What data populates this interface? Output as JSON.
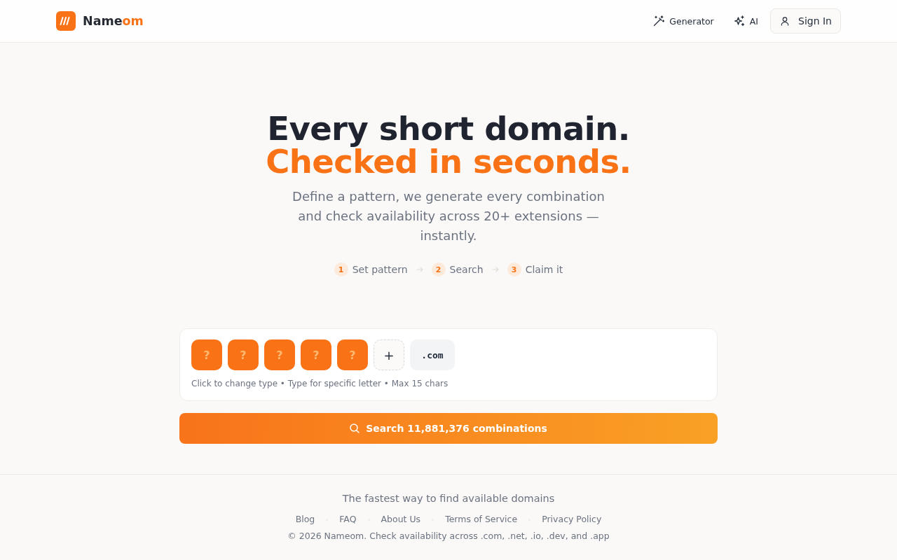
{
  "header": {
    "brand": {
      "name_start": "Name",
      "name_accent": "om"
    },
    "nav_links": [
      {
        "label": "Generator"
      },
      {
        "label": "AI"
      }
    ],
    "sign_in_button": {
      "label": "Sign In"
    }
  },
  "hero": {
    "title_line_1": "Every short domain.",
    "title_line_2": "Checked in seconds.",
    "subtitle": "Define a pattern, we generate every combination and check availability across 20+ extensions — instantly.",
    "steps": [
      {
        "number": "1",
        "label": "Set pattern"
      },
      {
        "number": "2",
        "label": "Search"
      },
      {
        "number": "3",
        "label": "Claim it"
      }
    ]
  },
  "pattern_builder": {
    "slots": [
      {
        "kind": "wildcard",
        "label": "?"
      },
      {
        "kind": "wildcard",
        "label": "?"
      },
      {
        "kind": "wildcard",
        "label": "?"
      },
      {
        "kind": "wildcard",
        "label": "?"
      },
      {
        "kind": "wildcard",
        "label": "?"
      },
      {
        "kind": "add",
        "label": "+"
      },
      {
        "kind": "tld",
        "label": ".com"
      }
    ],
    "hint": "Click to change type • Type for specific letter • Max 15 chars"
  },
  "search_button": {
    "label": "Search 11,881,376 combinations"
  },
  "footer": {
    "tagline": "The fastest way to find available domains",
    "links": [
      {
        "label": "Blog"
      },
      {
        "label": "FAQ"
      },
      {
        "label": "About Us"
      },
      {
        "label": "Terms of Service"
      },
      {
        "label": "Privacy Policy"
      }
    ],
    "copyright": "© 2026 Nameom. Check availability across .com, .net, .io, .dev, and .app"
  }
}
